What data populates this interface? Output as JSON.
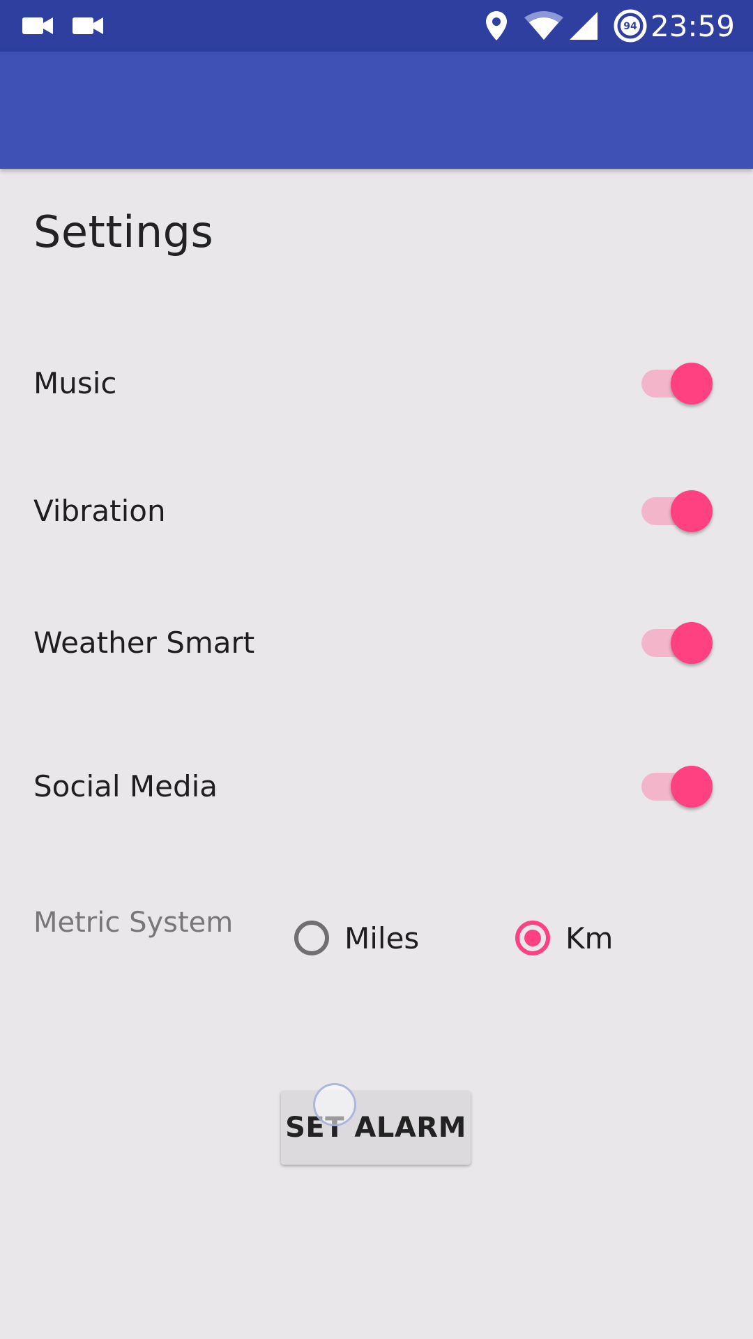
{
  "status_bar": {
    "time": "23:59",
    "battery_level": "94",
    "left_icons": [
      "video-camera-icon",
      "video-camera-icon"
    ],
    "right_icons": [
      "location-pin-icon",
      "wifi-icon",
      "cell-signal-icon",
      "battery-saver-icon"
    ],
    "background_color": "#2f3f9f"
  },
  "app_bar": {
    "background_color": "#3f51b5"
  },
  "page": {
    "title": "Settings"
  },
  "settings": [
    {
      "label": "Music",
      "enabled": true
    },
    {
      "label": "Vibration",
      "enabled": true
    },
    {
      "label": "Weather Smart",
      "enabled": true
    },
    {
      "label": "Social Media",
      "enabled": true
    }
  ],
  "metric": {
    "label": "Metric System",
    "options": [
      {
        "label": "Miles",
        "selected": false
      },
      {
        "label": "Km",
        "selected": true
      }
    ]
  },
  "actions": {
    "set_alarm_label": "SET ALARM"
  },
  "colors": {
    "accent": "#ff4081",
    "switch_track_on": "#f3b5ca",
    "background": "#e9e7ea"
  }
}
